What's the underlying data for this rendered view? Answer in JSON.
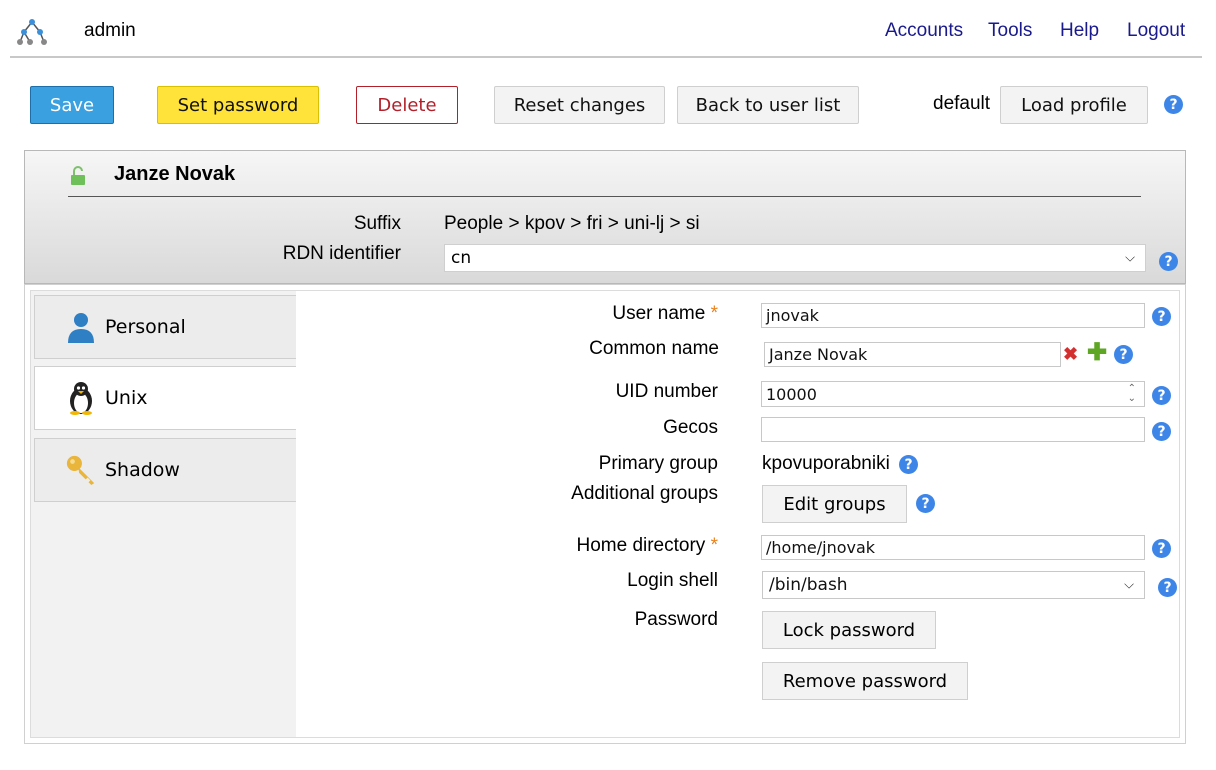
{
  "header": {
    "username": "admin",
    "nav": [
      "Accounts",
      "Tools",
      "Help",
      "Logout"
    ]
  },
  "toolbar": {
    "save": "Save",
    "set_password": "Set password",
    "delete": "Delete",
    "reset": "Reset changes",
    "back": "Back to user list",
    "profile": "default",
    "load_profile": "Load profile",
    "help": "?"
  },
  "title": {
    "name": "Janze Novak",
    "suffix_label": "Suffix",
    "suffix_value": "People > kpov > fri > uni-lj > si",
    "rdn_label": "RDN identifier",
    "rdn_value": "cn"
  },
  "tabs": [
    {
      "label": "Personal",
      "icon": "person-icon"
    },
    {
      "label": "Unix",
      "icon": "penguin-icon"
    },
    {
      "label": "Shadow",
      "icon": "key-icon"
    }
  ],
  "form": {
    "required_mark": "*",
    "user_name_label": "User name",
    "user_name": "jnovak",
    "common_name_label": "Common name",
    "common_name": "Janze Novak",
    "uid_label": "UID number",
    "uid": "10000",
    "gecos_label": "Gecos",
    "gecos": "",
    "primary_group_label": "Primary group",
    "primary_group": "kpovuporabniki",
    "additional_groups_label": "Additional groups",
    "edit_groups": "Edit groups",
    "home_label": "Home directory",
    "home": "/home/jnovak",
    "shell_label": "Login shell",
    "shell": "/bin/bash",
    "password_label": "Password",
    "lock_password": "Lock password",
    "remove_password": "Remove password"
  },
  "colors": {
    "save": "#3aa0e0",
    "set_password": "#ffe33a",
    "delete": "#b3202a",
    "help": "#3d86e8",
    "nav": "#1a1a8c"
  }
}
